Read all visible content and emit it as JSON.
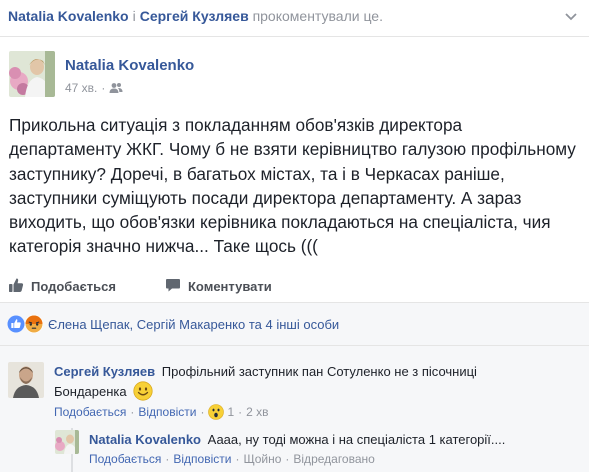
{
  "notice": {
    "name1": "Natalia Kovalenko",
    "separator": "і",
    "name2": "Сергей Кузляев",
    "suffix": "прокоментували це."
  },
  "post": {
    "author": "Natalia Kovalenko",
    "time": "47 хв.",
    "privacy_icon": "friends-icon",
    "text": "Прикольна ситуація з покладанням обов'язків директора департаменту ЖКГ. Чому б не взяти керівництво галузою профільному заступнику? Доречі, в багатьох містах, та і в Черкасах раніше, заступники суміщують посади директора департаменту. А зараз виходить, що обов'язки керівника покладаються на спеціаліста, чия категорія значно нижча... Таке щось (((",
    "accent": "#365899"
  },
  "actions": {
    "like_label": "Подобається",
    "comment_label": "Коментувати",
    "like_icon": "thumbs-up-icon",
    "comment_icon": "speech-bubble-icon"
  },
  "reactions": {
    "icons": [
      "like-reaction-icon",
      "angry-reaction-icon"
    ],
    "names": "Єлена Щепак, Сергій Макаренко та 4 інші особи"
  },
  "comments": [
    {
      "author": "Сергей Кузляев",
      "text": "Профільний заступник пан Сотуленко не з пісочниці Бондаренка",
      "emoji": "smile-emoji-icon",
      "like": "Подобається",
      "reply": "Відповісти",
      "reaction_icon": "wow-reaction-icon",
      "reaction_count": "1",
      "time": "2 хв"
    },
    {
      "author": "Natalia Kovalenko",
      "text": "Аааа, ну тоді можна і на спеціаліста 1 категорії....",
      "like": "Подобається",
      "reply": "Відповісти",
      "time": "Щойно",
      "edited": "Відредаговано"
    }
  ]
}
